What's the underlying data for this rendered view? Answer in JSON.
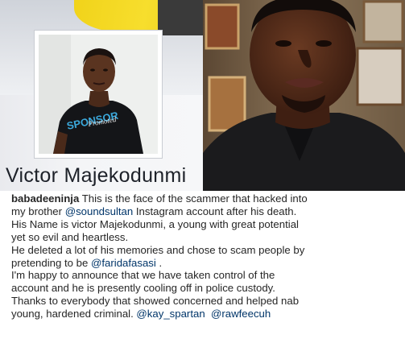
{
  "profile_card": {
    "name": "Victor Majekodunmi",
    "shirt_text_1": "SPONSOR",
    "shirt_text_2": "Promoted"
  },
  "caption": {
    "username": "babadeeninja",
    "line1_text": " This is the face of the scammer that hacked into",
    "line2_pre": "my brother ",
    "mention_1": "@soundsultan",
    "line2_post": " Instagram account after his death.",
    "line3": "His Name is victor Majekodunmi, a young with great potential",
    "line4": "yet so evil and heartless.",
    "line5": "He deleted a lot of his memories and chose to scam people by",
    "line6_pre": "pretending to be ",
    "mention_2": "@faridafasasi",
    "line6_post": " .",
    "line7": "I'm happy to announce that we have taken control of the",
    "line8": "account and he is presently cooling off in police custody.",
    "line9": "Thanks to everybody that showed concerned and helped nab",
    "line10_pre": "young, hardened criminal. ",
    "mention_3": "@kay_spartan",
    "line10_gap": "  ",
    "mention_4": "@rawfeecuh"
  },
  "colors": {
    "mention": "#003569",
    "text": "#262626",
    "cover_yellow": "#f3d622"
  }
}
